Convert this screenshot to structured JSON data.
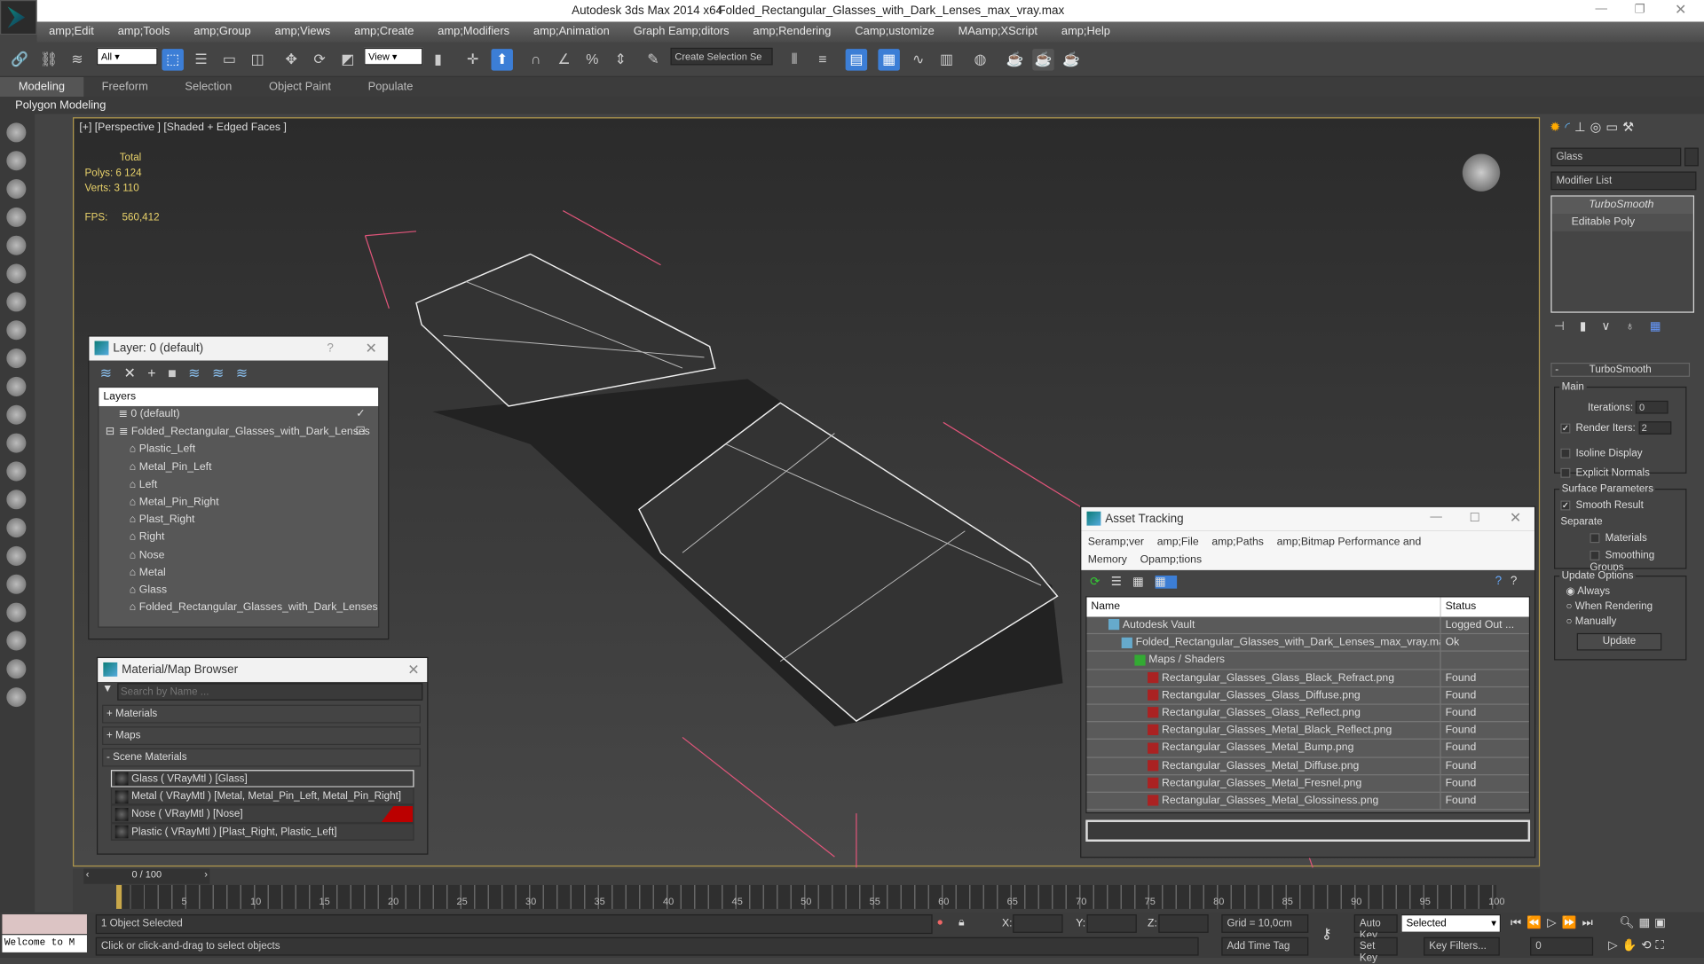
{
  "title": {
    "app": "Autodesk 3ds Max  2014 x64",
    "file": "Folded_Rectangular_Glasses_with_Dark_Lenses_max_vray.max"
  },
  "menu": [
    "amp;Edit",
    "amp;Tools",
    "amp;Group",
    "amp;Views",
    "amp;Create",
    "amp;Modifiers",
    "amp;Animation",
    "Graph Eamp;ditors",
    "amp;Rendering",
    "Camp;ustomize",
    "MAamp;XScript",
    "amp;Help"
  ],
  "toolbar": {
    "filter": "All",
    "refcoord": "View",
    "selset": "Create Selection Se"
  },
  "ribbon": {
    "tabs": [
      "Modeling",
      "Freeform",
      "Selection",
      "Object Paint",
      "Populate"
    ],
    "sub": "Polygon Modeling"
  },
  "viewport": {
    "label": "[+] [Perspective ] [Shaded + Edged Faces ]",
    "total": "Total",
    "polys_label": "Polys:",
    "polys": "6 124",
    "verts_label": "Verts:",
    "verts": "3 110",
    "fps_label": "FPS:",
    "fps": "560,412"
  },
  "layer_dialog": {
    "title": "Layer: 0 (default)",
    "help": "?",
    "column": "Layers",
    "layers": [
      "0 (default)",
      "Folded_Rectangular_Glasses_with_Dark_Lenses"
    ],
    "objects": [
      "Plastic_Left",
      "Metal_Pin_Left",
      "Left",
      "Metal_Pin_Right",
      "Plast_Right",
      "Right",
      "Nose",
      "Metal",
      "Glass",
      "Folded_Rectangular_Glasses_with_Dark_Lenses"
    ]
  },
  "material_browser": {
    "title": "Material/Map Browser",
    "search_placeholder": "Search by Name ...",
    "sections": [
      "+ Materials",
      "+ Maps",
      "- Scene Materials"
    ],
    "materials": [
      "Glass  ( VRayMtl ) [Glass]",
      "Metal  ( VRayMtl ) [Metal, Metal_Pin_Left, Metal_Pin_Right]",
      "Nose  ( VRayMtl ) [Nose]",
      "Plastic  ( VRayMtl ) [Plast_Right, Plastic_Left]"
    ]
  },
  "asset_tracking": {
    "title": "Asset Tracking",
    "menu": [
      "Seramp;ver",
      "amp;File",
      "amp;Paths",
      "amp;Bitmap Performance and Memory",
      "Opamp;tions"
    ],
    "col_name": "Name",
    "col_status": "Status",
    "rows": [
      {
        "name": "Autodesk Vault",
        "status": "Logged Out ...",
        "indent": 1
      },
      {
        "name": "Folded_Rectangular_Glasses_with_Dark_Lenses_max_vray.max",
        "status": "Ok",
        "indent": 2
      },
      {
        "name": "Maps / Shaders",
        "status": "",
        "indent": 3
      },
      {
        "name": "Rectangular_Glasses_Glass_Black_Refract.png",
        "status": "Found",
        "indent": 4
      },
      {
        "name": "Rectangular_Glasses_Glass_Diffuse.png",
        "status": "Found",
        "indent": 4
      },
      {
        "name": "Rectangular_Glasses_Glass_Reflect.png",
        "status": "Found",
        "indent": 4
      },
      {
        "name": "Rectangular_Glasses_Metal_Black_Reflect.png",
        "status": "Found",
        "indent": 4
      },
      {
        "name": "Rectangular_Glasses_Metal_Bump.png",
        "status": "Found",
        "indent": 4
      },
      {
        "name": "Rectangular_Glasses_Metal_Diffuse.png",
        "status": "Found",
        "indent": 4
      },
      {
        "name": "Rectangular_Glasses_Metal_Fresnel.png",
        "status": "Found",
        "indent": 4
      },
      {
        "name": "Rectangular_Glasses_Metal_Glossiness.png",
        "status": "Found",
        "indent": 4
      }
    ]
  },
  "command_panel": {
    "object_name": "Glass",
    "modifier_list": "Modifier List",
    "stack": [
      "TurboSmooth",
      "Editable Poly"
    ],
    "rollout": "TurboSmooth",
    "main": "Main",
    "iterations_label": "Iterations:",
    "iterations": "0",
    "render_iters_label": "Render Iters:",
    "render_iters": "2",
    "isoline": "Isoline Display",
    "explicit": "Explicit Normals",
    "surface": "Surface Parameters",
    "smooth_result": "Smooth Result",
    "separate": "Separate",
    "materials": "Materials",
    "smoothing_groups": "Smoothing Groups",
    "update_options": "Update Options",
    "always": "Always",
    "when_rendering": "When Rendering",
    "manually": "Manually",
    "update": "Update"
  },
  "timeline": {
    "frame": "0 / 100",
    "ticks": [
      "5",
      "10",
      "15",
      "20",
      "25",
      "30",
      "35",
      "40",
      "45",
      "50",
      "55",
      "60",
      "65",
      "70",
      "75",
      "80",
      "85",
      "90",
      "95",
      "100"
    ]
  },
  "status": {
    "welcome": "Welcome to M",
    "selected": "1 Object Selected",
    "prompt": "Click or click-and-drag to select objects",
    "x": "X:",
    "y": "Y:",
    "z": "Z:",
    "grid": "Grid = 10,0cm",
    "add_time_tag": "Add Time Tag",
    "auto_key": "Auto Key",
    "set_key": "Set Key",
    "key_mode": "Selected",
    "key_filters": "Key Filters...",
    "frame": "0"
  }
}
